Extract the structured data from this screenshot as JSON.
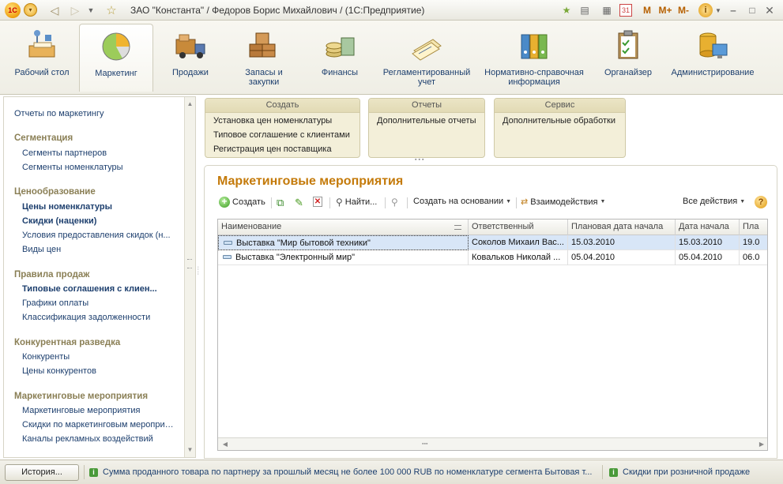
{
  "window": {
    "title": "ЗАО \"Константа\" / Федоров Борис Михайлович /  (1С:Предприятие)",
    "icons": [
      "1c-logo-icon",
      "main-menu-icon",
      "back-icon",
      "forward-icon",
      "history-dropdown-icon",
      "favorites-star-icon",
      "add-favorite-icon",
      "print-icon",
      "calculator-icon",
      "calendar-icon",
      "info-icon",
      "minimize-icon",
      "restore-icon",
      "close-icon"
    ],
    "calendar_day": "31",
    "memory_buttons": [
      "M",
      "M+",
      "M-"
    ]
  },
  "sections": [
    {
      "label": "Рабочий стол",
      "icon": "desktop-icon"
    },
    {
      "label": "Маркетинг",
      "icon": "pie-chart-icon",
      "active": true
    },
    {
      "label": "Продажи",
      "icon": "delivery-truck-icon"
    },
    {
      "label": "Запасы и закупки",
      "icon": "warehouse-boxes-icon"
    },
    {
      "label": "Финансы",
      "icon": "coins-icon"
    },
    {
      "label": "Регламентированный учет",
      "icon": "documents-icon"
    },
    {
      "label": "Нормативно-справочная информация",
      "icon": "binders-icon"
    },
    {
      "label": "Органайзер",
      "icon": "clipboard-icon"
    },
    {
      "label": "Администрирование",
      "icon": "database-monitor-icon"
    }
  ],
  "nav": {
    "top_link": "Отчеты по маркетингу",
    "groups": [
      {
        "title": "Сегментация",
        "items": [
          {
            "label": "Сегменты партнеров",
            "bold": false
          },
          {
            "label": "Сегменты номенклатуры",
            "bold": false
          }
        ]
      },
      {
        "title": "Ценообразование",
        "items": [
          {
            "label": "Цены номенклатуры",
            "bold": true
          },
          {
            "label": "Скидки (наценки)",
            "bold": true
          },
          {
            "label": "Условия предоставления скидок (н...",
            "bold": false
          },
          {
            "label": "Виды цен",
            "bold": false
          }
        ]
      },
      {
        "title": "Правила продаж",
        "items": [
          {
            "label": "Типовые соглашения с клиен...",
            "bold": true
          },
          {
            "label": "Графики оплаты",
            "bold": false
          },
          {
            "label": "Классификация задолженности",
            "bold": false
          }
        ]
      },
      {
        "title": "Конкурентная разведка",
        "items": [
          {
            "label": "Конкуренты",
            "bold": false
          },
          {
            "label": "Цены конкурентов",
            "bold": false
          }
        ]
      },
      {
        "title": "Маркетинговые мероприятия",
        "items": [
          {
            "label": "Маркетинговые мероприятия",
            "bold": false
          },
          {
            "label": "Скидки по маркетинговым мероприятиям",
            "bold": false
          },
          {
            "label": "Каналы рекламных воздействий",
            "bold": false
          }
        ]
      }
    ]
  },
  "panels": [
    {
      "title": "Создать",
      "commands": [
        "Установка цен номенклатуры",
        "Типовое соглашение с клиентами",
        "Регистрация цен поставщика"
      ]
    },
    {
      "title": "Отчеты",
      "commands": [
        "Дополнительные отчеты"
      ]
    },
    {
      "title": "Сервис",
      "commands": [
        "Дополнительные обработки"
      ]
    }
  ],
  "form": {
    "title": "Маркетинговые мероприятия",
    "toolbar": {
      "create": "Создать",
      "find": "Найти...",
      "create_based_on": "Создать на основании",
      "interactions": "Взаимодействия",
      "all_actions": "Все действия",
      "help": "?"
    },
    "columns": [
      "Наименование",
      "Ответственный",
      "Плановая дата начала",
      "Дата начала",
      "Пла"
    ],
    "rows": [
      [
        "Выставка \"Мир бытовой техники\"",
        "Соколов Михаил Вас...",
        "15.03.2010",
        "15.03.2010",
        "19.0"
      ],
      [
        "Выставка \"Электронный мир\"",
        "Ковальков Николай ...",
        "05.04.2010",
        "05.04.2010",
        "06.0"
      ]
    ]
  },
  "status": {
    "history_button": "История...",
    "tips": [
      "Сумма проданного товара по партнеру за прошлый месяц не более 100 000 RUB по номенклатуре сегмента Бытовая т...",
      "Скидки при розничной продаже"
    ]
  }
}
